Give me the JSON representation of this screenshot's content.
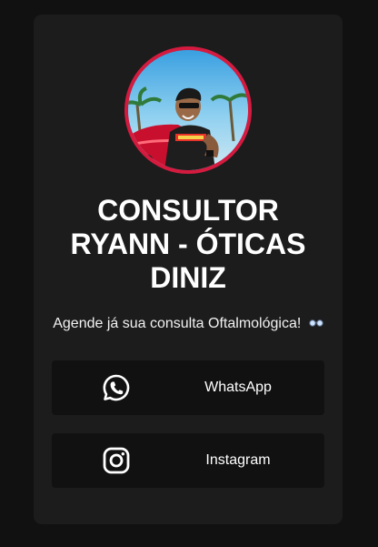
{
  "profile": {
    "name": "CONSULTOR RYANN - ÓTICAS DINIZ",
    "bio": "Agende já sua consulta Oftalmológica!",
    "bio_emoji": "eyeglasses-icon",
    "avatar_ring_color": "#d41b3f"
  },
  "links": [
    {
      "label": "WhatsApp",
      "icon": "whatsapp-icon"
    },
    {
      "label": "Instagram",
      "icon": "instagram-icon"
    }
  ],
  "colors": {
    "page_background": "#111111",
    "card_background": "#1c1c1c",
    "button_background": "#111111",
    "text": "#ffffff"
  }
}
